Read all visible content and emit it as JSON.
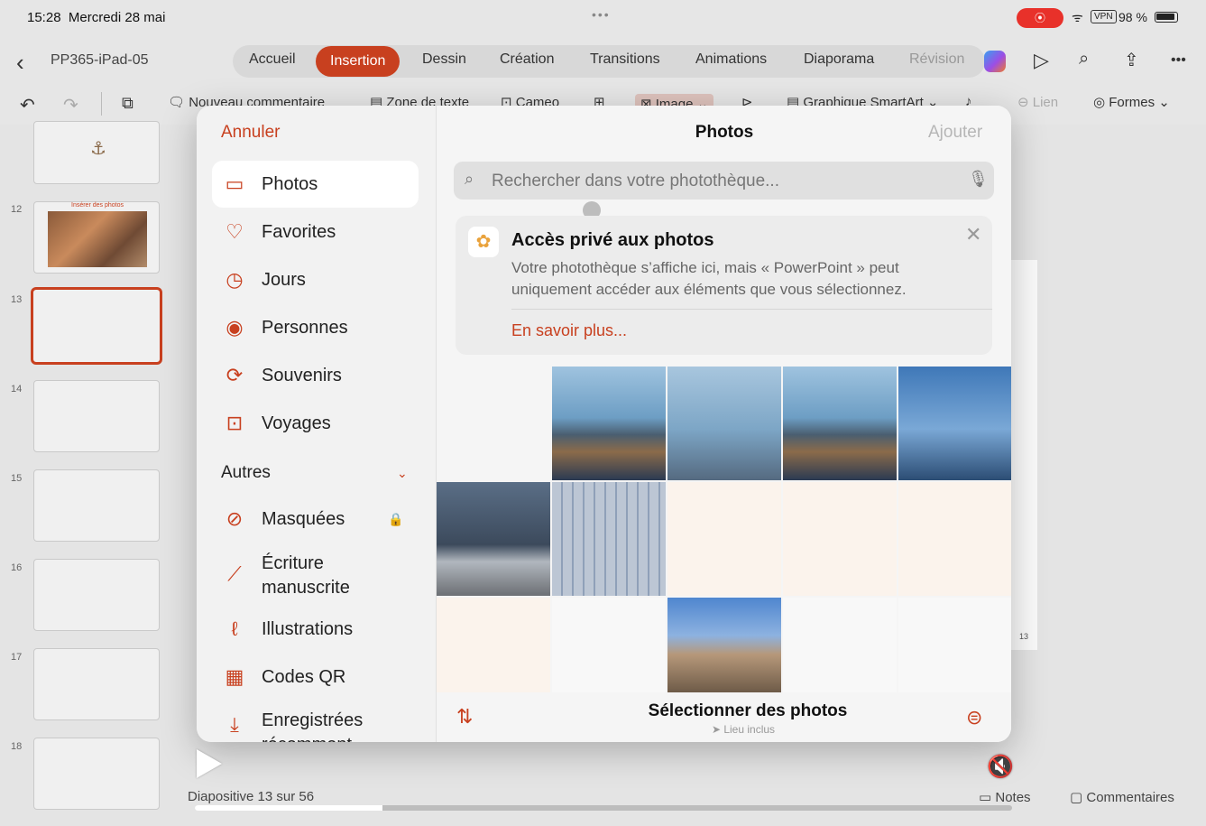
{
  "status": {
    "time": "15:28",
    "date": "Mercredi 28 mai",
    "dots": "•••",
    "record": "⦿",
    "wifi": "ᯤ",
    "vpn": "VPN",
    "battery": "98 %"
  },
  "ribbon": {
    "doc_name": "PP365-iPad-05",
    "tabs": [
      "Accueil",
      "Insertion",
      "Dessin",
      "Création",
      "Transitions",
      "Animations",
      "Diaporama",
      "Révision"
    ],
    "active_tab": "Insertion"
  },
  "toolbar": {
    "new_comment": "Nouveau commentaire",
    "text_box": "Zone de texte",
    "cameo": "Cameo",
    "image": "Image",
    "smartart": "Graphique SmartArt",
    "link": "Lien",
    "shapes": "Formes"
  },
  "slides": {
    "numbers": [
      "12",
      "13",
      "14",
      "15",
      "16",
      "17",
      "18"
    ],
    "thumb_caption": "Insérer des photos",
    "current_slide_number": "13"
  },
  "bottom": {
    "status": "Diapositive 13 sur 56",
    "notes": "Notes",
    "comments": "Commentaires",
    "progress": 0.23
  },
  "picker": {
    "cancel": "Annuler",
    "title": "Photos",
    "add": "Ajouter",
    "sidebar": [
      {
        "label": "Photos",
        "icon": "photos-stack-icon",
        "glyph": "▭",
        "selected": true
      },
      {
        "label": "Favorites",
        "icon": "heart-icon",
        "glyph": "♡"
      },
      {
        "label": "Jours",
        "icon": "clock-icon",
        "glyph": "◷"
      },
      {
        "label": "Personnes",
        "icon": "person-circle-icon",
        "glyph": "◉"
      },
      {
        "label": "Souvenirs",
        "icon": "memories-icon",
        "glyph": "⟳"
      },
      {
        "label": "Voyages",
        "icon": "suitcase-icon",
        "glyph": "⊡"
      }
    ],
    "autres": "Autres",
    "autres_items": [
      {
        "label": "Masquées",
        "icon": "eye-slash-icon",
        "glyph": "⊘",
        "locked": true
      },
      {
        "label": "Écriture manuscrite",
        "icon": "pen-icon",
        "glyph": "⟋"
      },
      {
        "label": "Illustrations",
        "icon": "scribble-icon",
        "glyph": "ℓ"
      },
      {
        "label": "Codes QR",
        "icon": "qr-code-icon",
        "glyph": "▦"
      },
      {
        "label": "Enregistrées récemment",
        "icon": "download-icon",
        "glyph": "⤓"
      }
    ],
    "search_placeholder": "Rechercher dans votre photothèque...",
    "banner": {
      "title": "Accès privé aux photos",
      "text": "Votre photothèque s’affiche ici, mais « PowerPoint » peut uniquement accéder aux éléments que vous sélectionnez.",
      "link": "En savoir plus..."
    },
    "grid": {
      "row_1": [
        "blank",
        "ipad",
        "folder",
        "ipad",
        "ship"
      ],
      "row_2": [
        "desk",
        "calendar",
        "doc",
        "doc",
        "doc"
      ],
      "row_3": [
        "doc",
        "white",
        "tower",
        "white",
        "white"
      ]
    },
    "bottom_bar": {
      "title": "Sélectionner des photos",
      "subtitle": "Lieu inclus",
      "sort_glyph": "⇅",
      "toggle_glyph": "⊜"
    }
  },
  "colors": {
    "accent": "#c8401f"
  }
}
